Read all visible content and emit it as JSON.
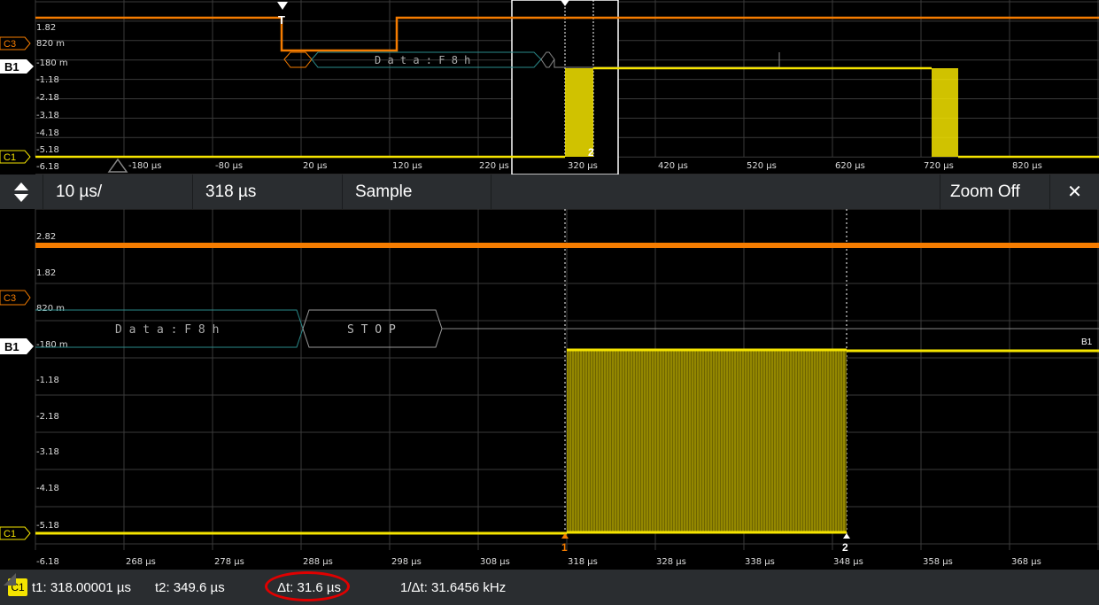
{
  "overview": {
    "y_labels": [
      "1.82",
      "820 m",
      "-180 m",
      "-1.18",
      "-2.18",
      "-3.18",
      "-4.18",
      "-5.18",
      "-6.18"
    ],
    "x_labels": [
      "-180 µs",
      "-80 µs",
      "20 µs",
      "120 µs",
      "220 µs",
      "320 µs",
      "420 µs",
      "520 µs",
      "620 µs",
      "720 µs",
      "820 µs"
    ],
    "decode_text": "D a t a : F 8 h",
    "ch_c3": "C3",
    "ch_b1": "B1",
    "ch_c1": "C1",
    "trigger_letter": "T",
    "cursor2_label": "2"
  },
  "toolbar": {
    "timebase": "10 µs/",
    "position": "318 µs",
    "mode": "Sample",
    "zoom_state": "Zoom Off",
    "close": "✕"
  },
  "zoom": {
    "y_labels": [
      "2.82",
      "1.82",
      "820 m",
      "-180 m",
      "-1.18",
      "-2.18",
      "-3.18",
      "-4.18",
      "-5.18",
      "-6.18"
    ],
    "x_labels": [
      "268 µs",
      "278 µs",
      "288 µs",
      "298 µs",
      "308 µs",
      "318 µs",
      "328 µs",
      "338 µs",
      "348 µs",
      "358 µs",
      "368 µs"
    ],
    "decode_data": "D a t a : F 8 h",
    "decode_stop": "S T O P",
    "ch_c3": "C3",
    "ch_b1": "B1",
    "ch_c1": "C1",
    "b1_right": "B1",
    "cursor1_label": "1",
    "cursor2_label": "2"
  },
  "status": {
    "channel": "C1",
    "t1": "t1: 318.00001 µs",
    "t2": "t2: 349.6 µs",
    "dt": "Δt: 31.6 µs",
    "inv_dt": "1/Δt: 31.6456 kHz"
  },
  "colors": {
    "c1": "#f5e400",
    "c3": "#f57c00",
    "b1_decode": "#2a8a8a",
    "grid": "#3a3a3a"
  }
}
